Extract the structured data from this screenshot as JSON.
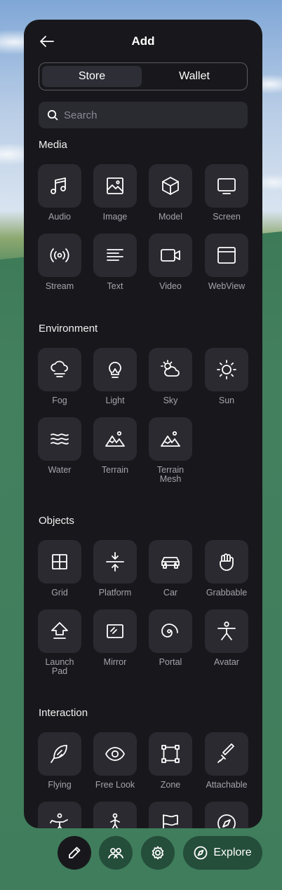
{
  "header": {
    "title": "Add",
    "back_icon": "arrow-left-icon"
  },
  "tabs": [
    {
      "label": "Store",
      "active": true
    },
    {
      "label": "Wallet",
      "active": false
    }
  ],
  "search": {
    "placeholder": "Search"
  },
  "sections": [
    {
      "title": "Media",
      "items": [
        {
          "label": "Audio",
          "icon": "music-note-icon"
        },
        {
          "label": "Image",
          "icon": "image-icon"
        },
        {
          "label": "Model",
          "icon": "cube-icon"
        },
        {
          "label": "Screen",
          "icon": "monitor-icon"
        },
        {
          "label": "Stream",
          "icon": "broadcast-icon"
        },
        {
          "label": "Text",
          "icon": "text-lines-icon"
        },
        {
          "label": "Video",
          "icon": "video-camera-icon"
        },
        {
          "label": "WebView",
          "icon": "browser-window-icon"
        }
      ]
    },
    {
      "title": "Environment",
      "items": [
        {
          "label": "Fog",
          "icon": "fog-cloud-icon"
        },
        {
          "label": "Light",
          "icon": "light-bulb-icon"
        },
        {
          "label": "Sky",
          "icon": "partly-cloudy-icon"
        },
        {
          "label": "Sun",
          "icon": "sun-icon"
        },
        {
          "label": "Water",
          "icon": "waves-icon"
        },
        {
          "label": "Terrain",
          "icon": "mountains-icon"
        },
        {
          "label": "Terrain Mesh",
          "icon": "mountains-mesh-icon"
        }
      ]
    },
    {
      "title": "Objects",
      "items": [
        {
          "label": "Grid",
          "icon": "grid-icon"
        },
        {
          "label": "Platform",
          "icon": "platform-arrows-icon"
        },
        {
          "label": "Car",
          "icon": "car-icon"
        },
        {
          "label": "Grabbable",
          "icon": "hand-grab-icon"
        },
        {
          "label": "Launch Pad",
          "icon": "launch-arrow-icon"
        },
        {
          "label": "Mirror",
          "icon": "mirror-icon"
        },
        {
          "label": "Portal",
          "icon": "spiral-portal-icon"
        },
        {
          "label": "Avatar",
          "icon": "person-icon"
        }
      ]
    },
    {
      "title": "Interaction",
      "items": [
        {
          "label": "Flying",
          "icon": "feather-icon"
        },
        {
          "label": "Free Look",
          "icon": "eye-icon"
        },
        {
          "label": "Zone",
          "icon": "zone-square-icon"
        },
        {
          "label": "Attachable",
          "icon": "sword-icon"
        },
        {
          "label": "",
          "icon": "person-dance-icon"
        },
        {
          "label": "",
          "icon": "person-sit-icon"
        },
        {
          "label": "",
          "icon": "flag-icon"
        },
        {
          "label": "",
          "icon": "compass-icon"
        }
      ]
    }
  ],
  "bottom_bar": {
    "edit_icon": "pencil-icon",
    "people_icon": "people-icon",
    "settings_icon": "gear-icon",
    "explore_label": "Explore",
    "explore_icon": "compass-icon"
  },
  "colors": {
    "panel_bg": "#18181c",
    "tile_bg": "#2a2a30",
    "label": "#a3a3ab",
    "ground": "#3f7d5c"
  }
}
